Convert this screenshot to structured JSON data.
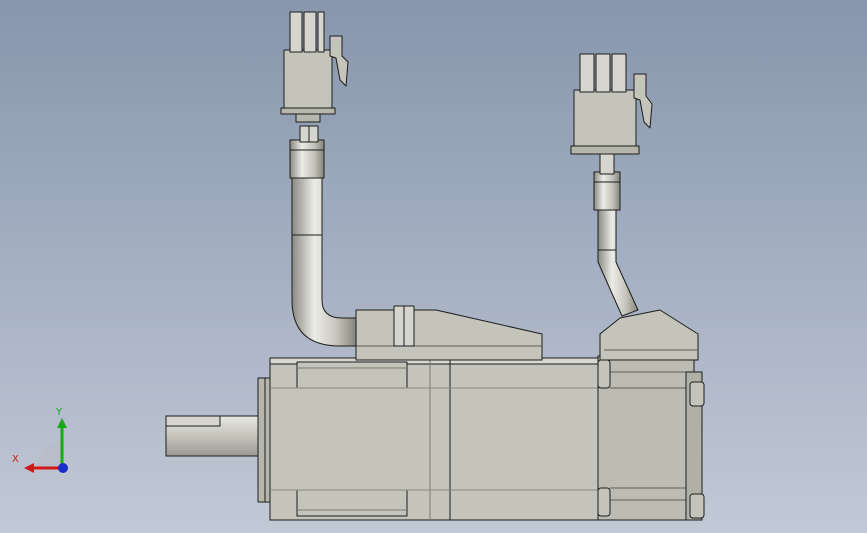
{
  "viewport": {
    "background_top": "#8796ad",
    "background_bottom": "#c2c9d6"
  },
  "model": {
    "body_color": "#c4c4bb",
    "edge_color": "#1c1c1c",
    "shadow_color": "#a9a9a0",
    "highlight_color": "#ecece6"
  },
  "triad": {
    "x_label": "X",
    "y_label": "Y",
    "x_color": "#d01818",
    "y_color": "#18a818",
    "z_color": "#1830c8"
  }
}
